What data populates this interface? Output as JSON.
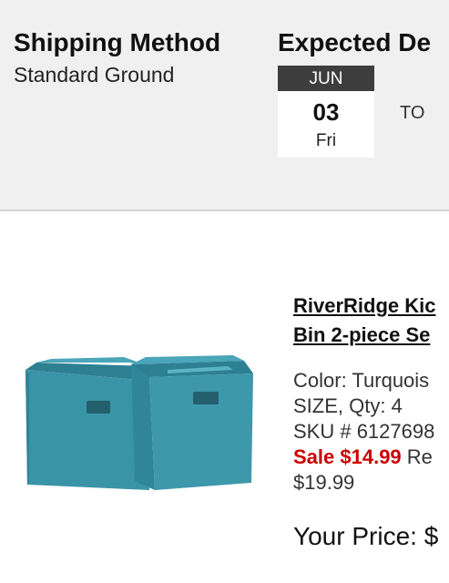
{
  "shipping": {
    "title": "Shipping Method",
    "method": "Standard Ground"
  },
  "delivery": {
    "title": "Expected De",
    "month": "JUN",
    "day": "03",
    "weekday": "Fri",
    "to_label": "TO"
  },
  "product": {
    "name_line1": "RiverRidge Kic",
    "name_line2": "Bin 2-piece Se",
    "color_label": "Color: Turquois",
    "size_qty": "SIZE, Qty: 4",
    "sku": "SKU # 6127698",
    "sale_label": "Sale $14.99",
    "regular_label": " Re",
    "regular_price": "$19.99",
    "your_price_label": "Your Price: $",
    "image_color": "#3d96a8"
  }
}
